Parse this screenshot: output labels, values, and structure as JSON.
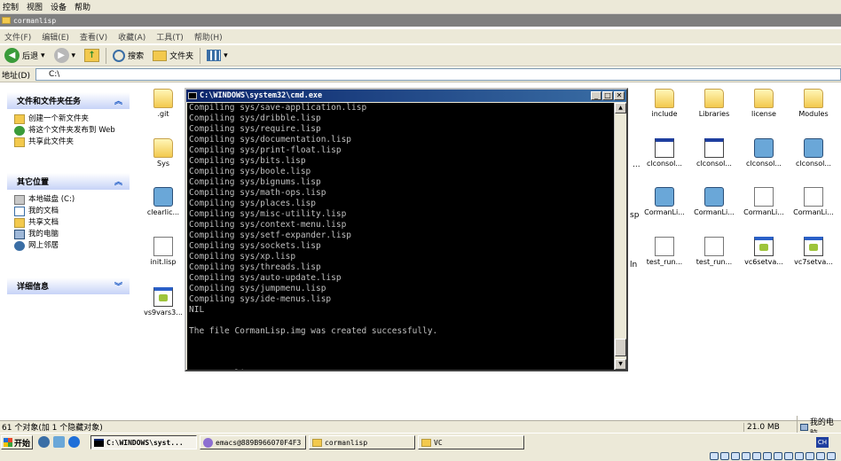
{
  "top_menu": [
    "控制",
    "视图",
    "设备",
    "帮助"
  ],
  "explorer": {
    "title": "cormanlisp",
    "menu": [
      "文件(F)",
      "编辑(E)",
      "查看(V)",
      "收藏(A)",
      "工具(T)",
      "帮助(H)"
    ],
    "toolbar": {
      "back_label": "后退",
      "search_label": "搜索",
      "folders_label": "文件夹"
    },
    "address_label": "地址(D)",
    "address_value": "C:\\"
  },
  "left_panel": {
    "file_tasks": {
      "title": "文件和文件夹任务",
      "items": [
        "创建一个新文件夹",
        "将这个文件夹发布到 Web",
        "共享此文件夹"
      ]
    },
    "other_places": {
      "title": "其它位置",
      "items": [
        "本地磁盘 (C:)",
        "我的文档",
        "共享文档",
        "我的电脑",
        "网上邻居"
      ]
    },
    "details": {
      "title": "详细信息"
    }
  },
  "files_left": [
    {
      "name": ".git"
    },
    {
      "name": "Sys"
    },
    {
      "name": "clearlic..."
    },
    {
      "name": "init.lisp"
    },
    {
      "name": "vs9vars3..."
    }
  ],
  "files_right": [
    "include",
    "Libraries",
    "license",
    "Modules",
    "clconsol...",
    "clconsol...",
    "clconsol...",
    "clconsol...",
    "CormanLi...",
    "CormanLi...",
    "CormanLi...",
    "CormanLi...",
    "test_run...",
    "test_run...",
    "vc6setva...",
    "vc7setva..."
  ],
  "partial_labels": [
    "...",
    "sp",
    "ln"
  ],
  "cmd": {
    "title": "C:\\WINDOWS\\system32\\cmd.exe",
    "lines": [
      "Compiling sys/save-application.lisp",
      "Compiling sys/dribble.lisp",
      "Compiling sys/require.lisp",
      "Compiling sys/documentation.lisp",
      "Compiling sys/print-float.lisp",
      "Compiling sys/bits.lisp",
      "Compiling sys/boole.lisp",
      "Compiling sys/bignums.lisp",
      "Compiling sys/math-ops.lisp",
      "Compiling sys/places.lisp",
      "Compiling sys/misc-utility.lisp",
      "Compiling sys/context-menu.lisp",
      "Compiling sys/setf-expander.lisp",
      "Compiling sys/sockets.lisp",
      "Compiling sys/xp.lisp",
      "Compiling sys/threads.lisp",
      "Compiling sys/auto-update.lisp",
      "Compiling sys/jumpmenu.lisp",
      "Compiling sys/ide-menus.lisp",
      "NIL",
      "",
      "The file CormanLisp.img was created successfully.",
      "",
      "",
      "",
      "C:\\cormanlisp>"
    ]
  },
  "status": {
    "left": "61 个对象(加 1 个隐藏对象)",
    "size": "21.0 MB",
    "location": "我的电脑"
  },
  "taskbar": {
    "start_label": "开始",
    "tasks": [
      "C:\\WINDOWS\\syst...",
      "emacs@889B966070F4F3",
      "cormanlisp",
      "VC"
    ],
    "ime": "CH"
  },
  "colors": {
    "panel_bg": "#d6dff7",
    "title_blue": "#0a246a",
    "console_text": "#c0c0c0"
  }
}
